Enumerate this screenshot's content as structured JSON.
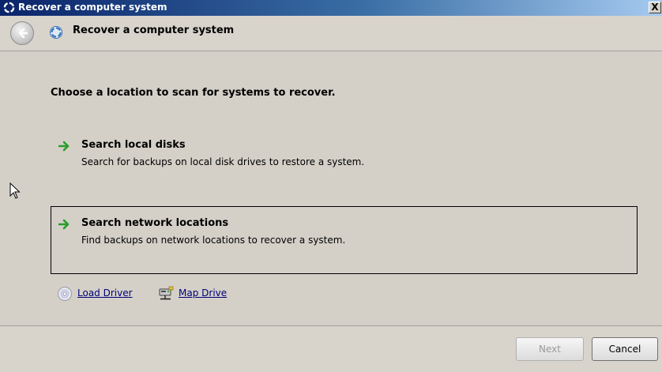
{
  "window": {
    "title": "Recover a computer system",
    "title_icon": "recovery-icon",
    "close_label": "X"
  },
  "header": {
    "back_icon": "back-arrow-icon",
    "title": "Recover a computer system",
    "title_icon": "recovery-icon"
  },
  "main": {
    "instruction": "Choose a location to scan for systems to recover.",
    "options": [
      {
        "title": "Search local disks",
        "description": "Search for backups on local disk drives to restore a system.",
        "icon": "green-arrow-icon"
      },
      {
        "title": "Search network locations",
        "description": "Find backups on network locations to recover a system.",
        "icon": "green-arrow-icon",
        "selected": true
      }
    ],
    "links": [
      {
        "label": "Load Driver",
        "icon": "cd-icon"
      },
      {
        "label": "Map Drive",
        "icon": "network-drive-icon"
      }
    ]
  },
  "footer": {
    "next_label": "Next",
    "next_enabled": false,
    "cancel_label": "Cancel"
  },
  "colors": {
    "title_bar_start": "#0a246a",
    "title_bar_end": "#a6caf0",
    "background": "#d4d0c8",
    "link": "#00007a",
    "arrow_green": "#2a9d2a"
  }
}
